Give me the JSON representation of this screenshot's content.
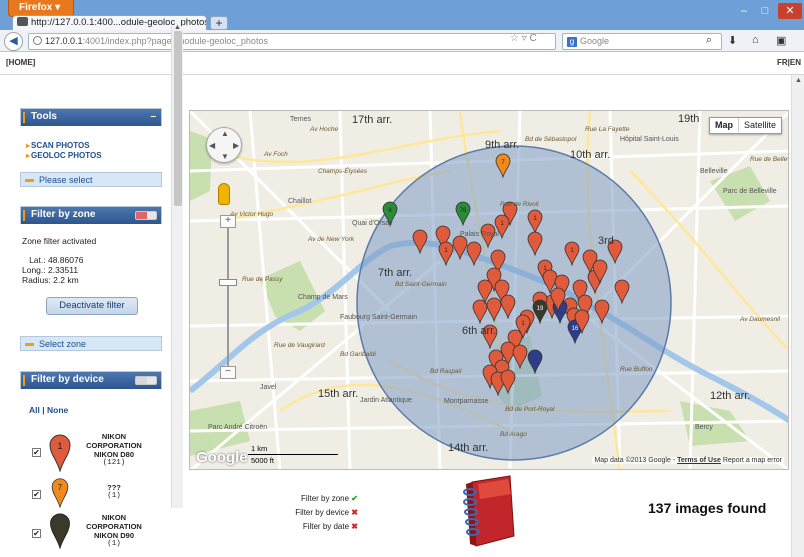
{
  "browser": {
    "menu_button": "Firefox ▾",
    "tab_title": "http://127.0.0.1:400...odule-geoloc_photos",
    "new_tab": "+",
    "url_host": "127.0.0.1",
    "url_rest": ":4001/index.php?page=module-geoloc_photos",
    "search_placeholder": "Google",
    "minimize": "–",
    "maximize": "□",
    "close": "✕"
  },
  "menubar": {
    "home": "[HOME]",
    "lang": "FR|EN"
  },
  "tools_panel": {
    "title": "Tools",
    "links": [
      "SCAN PHOTOS",
      "GEOLOC PHOTOS"
    ],
    "footer": "Please select"
  },
  "zone_panel": {
    "title": "Filter by zone",
    "status": "Zone filter activated",
    "lat": "   Lat.: 48.86076",
    "long": "Long.: 2.33511",
    "radius": "Radius: 2.2 km",
    "button": "Deactivate filter",
    "footer": "Select zone"
  },
  "device_panel": {
    "title": "Filter by device",
    "all": "All",
    "sep": "|",
    "none": "None",
    "devices": [
      {
        "name": "NIKON CORPORATION NIKON D80",
        "count": "(121)",
        "color": "#e05a3c",
        "pin_label": "1",
        "checked": true
      },
      {
        "name": "???",
        "count": "(1)",
        "color": "#f08a1c",
        "pin_label": "7",
        "checked": true
      },
      {
        "name": "NIKON CORPORATION NIKON D90",
        "count": "(1)",
        "color": "#3a3a2a",
        "pin_label": "",
        "checked": true
      }
    ]
  },
  "map": {
    "type_map": "Map",
    "type_satellite": "Satellite",
    "brand": "Google",
    "scale_km": "1 km",
    "scale_ft": "5000 ft",
    "attribution": "Map data ©2013 Google -",
    "terms": "Terms of Use",
    "report": "Report a map error",
    "labels": [
      {
        "text": "17th arr.",
        "cls": "big"
      },
      {
        "text": "9th arr.",
        "cls": "big"
      },
      {
        "text": "10th arr.",
        "cls": "big"
      },
      {
        "text": "7th arr.",
        "cls": "big"
      },
      {
        "text": "6th arr.",
        "cls": "big"
      },
      {
        "text": "3rd",
        "cls": "big"
      },
      {
        "text": "15th arr.",
        "cls": "big"
      },
      {
        "text": "14th arr.",
        "cls": "big"
      },
      {
        "text": "12th arr.",
        "cls": "big"
      },
      {
        "text": "19th",
        "cls": "big"
      },
      {
        "text": "Ternes",
        "cls": "sm"
      },
      {
        "text": "Hôpital Saint-Louis",
        "cls": "sm"
      },
      {
        "text": "Belleville",
        "cls": "sm"
      },
      {
        "text": "Chaillot",
        "cls": "sm"
      },
      {
        "text": "Champ de Mars",
        "cls": "sm"
      },
      {
        "text": "Faubourg Saint-Germain",
        "cls": "sm"
      },
      {
        "text": "Javel",
        "cls": "sm"
      },
      {
        "text": "Jardin Atlantique",
        "cls": "sm"
      },
      {
        "text": "Montparnasse",
        "cls": "sm"
      },
      {
        "text": "Parc André Citroën",
        "cls": "sm"
      },
      {
        "text": "Bercy",
        "cls": "sm"
      },
      {
        "text": "Parc de Belleville",
        "cls": "sm"
      },
      {
        "text": "Palais Royal",
        "cls": "sm"
      },
      {
        "text": "Quai d'Orsay",
        "cls": "sm"
      },
      {
        "text": "Av Foch",
        "cls": "rd"
      },
      {
        "text": "Champs-Élysées",
        "cls": "rd"
      },
      {
        "text": "Av Hoche",
        "cls": "rd"
      },
      {
        "text": "Av Victor Hugo",
        "cls": "rd"
      },
      {
        "text": "Av de New York",
        "cls": "rd"
      },
      {
        "text": "Rue de Passy",
        "cls": "rd"
      },
      {
        "text": "Bd Garibaldi",
        "cls": "rd"
      },
      {
        "text": "Bd Raspail",
        "cls": "rd"
      },
      {
        "text": "Rue de Vaugirard",
        "cls": "rd"
      },
      {
        "text": "Bd de Port-Royal",
        "cls": "rd"
      },
      {
        "text": "Bd Arago",
        "cls": "rd"
      },
      {
        "text": "Bd Saint-Germain",
        "cls": "rd"
      },
      {
        "text": "Rue Buffon",
        "cls": "rd"
      },
      {
        "text": "Rue de Belleville",
        "cls": "rd"
      },
      {
        "text": "Av Daumesnil",
        "cls": "rd"
      },
      {
        "text": "Bd de Sébastopol",
        "cls": "rd"
      },
      {
        "text": "Rue La Fayette",
        "cls": "rd"
      },
      {
        "text": "Rue de Rivoli",
        "cls": "rd"
      }
    ]
  },
  "results": {
    "filter_zone": "Filter by zone",
    "filter_device": "Filter by device",
    "filter_date": "Filter by date",
    "ok_mark": "✔",
    "x_mark": "✖",
    "found": "137 images found"
  },
  "colors": {
    "panel_header": "#2d5690",
    "circle_fill": "#7d9cc4",
    "pin_red": "#e05a3c",
    "pin_orange": "#f08a1c",
    "pin_green": "#2a8c3a",
    "pin_navy": "#2e3d8a",
    "pin_dark": "#3a3a2a"
  }
}
